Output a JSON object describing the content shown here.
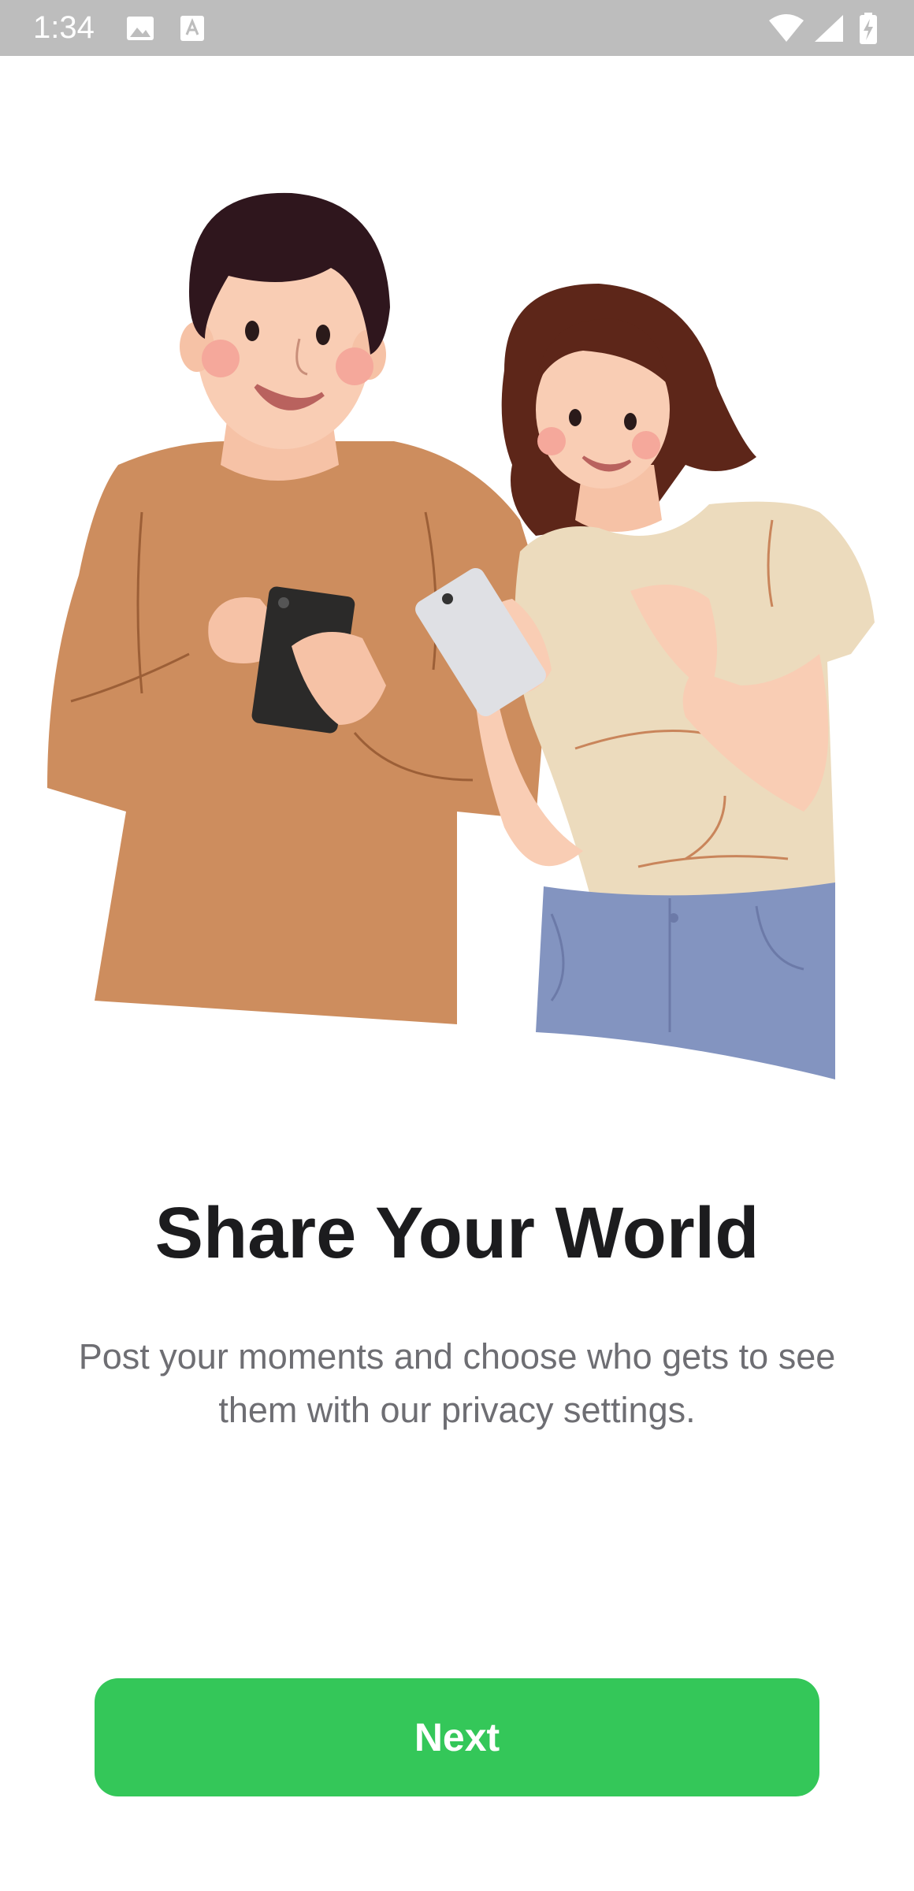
{
  "status_bar": {
    "time": "1:34",
    "icons": [
      "image-icon",
      "text-a-icon",
      "wifi-icon",
      "signal-icon",
      "battery-charging-icon"
    ]
  },
  "onboarding": {
    "title": "Share Your World",
    "subtitle": "Post your moments and choose who gets to see them with our privacy settings.",
    "next_label": "Next"
  },
  "colors": {
    "status_bar": "#bdbdbd",
    "primary_button": "#34c759",
    "title": "#1c1c1e",
    "subtitle": "#6e6e73"
  }
}
